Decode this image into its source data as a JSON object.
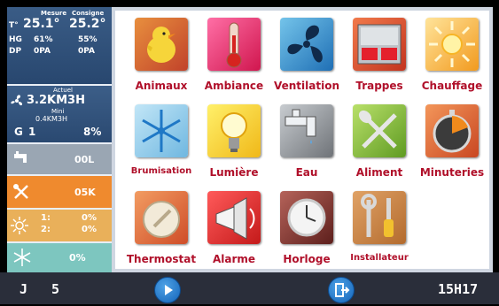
{
  "sidebar": {
    "mesure": {
      "header_mesure": "Mesure",
      "header_consigne": "Consigne",
      "t_label": "T°",
      "t_mesure": "25.1°",
      "t_consigne": "25.2°",
      "hg_label": "HG",
      "hg_mesure": "61%",
      "hg_consigne": "55%",
      "dp_label": "DP",
      "dp_mesure": "0PA",
      "dp_consigne": "0PA"
    },
    "air": {
      "actuel_label": "Actuel",
      "actuel_value": "3.2KM3H",
      "mini_label": "Mini",
      "mini_value": "0.4KM3H",
      "g_label": "G",
      "g_value": "1",
      "percent": "8%"
    },
    "eau": {
      "value": "00L"
    },
    "aliment": {
      "value": "05K"
    },
    "chauffage": {
      "line1_label": "1:",
      "line1_value": "0%",
      "line2_label": "2:",
      "line2_value": "0%"
    },
    "brumisation": {
      "value": "0%"
    }
  },
  "tiles": [
    {
      "label": "Animaux",
      "icon": "chick-icon"
    },
    {
      "label": "Ambiance",
      "icon": "thermometer-icon"
    },
    {
      "label": "Ventilation",
      "icon": "fan-icon"
    },
    {
      "label": "Trappes",
      "icon": "trap-door-icon"
    },
    {
      "label": "Chauffage",
      "icon": "sun-icon"
    },
    {
      "label": "Brumisation",
      "icon": "snowflake-icon"
    },
    {
      "label": "Lumière",
      "icon": "lightbulb-icon"
    },
    {
      "label": "Eau",
      "icon": "faucet-icon"
    },
    {
      "label": "Aliment",
      "icon": "fork-spoon-icon"
    },
    {
      "label": "Minuteries",
      "icon": "stopwatch-icon"
    },
    {
      "label": "Thermostat",
      "icon": "dial-icon"
    },
    {
      "label": "Alarme",
      "icon": "megaphone-icon"
    },
    {
      "label": "Horloge",
      "icon": "clock-icon"
    },
    {
      "label": "Installateur",
      "icon": "tools-icon"
    }
  ],
  "footer": {
    "day_label": "J",
    "day_value": "5",
    "time": "15H17",
    "play_icon": "play-icon",
    "exit_icon": "exit-icon"
  },
  "colors": {
    "label_red": "#b0102a",
    "panel_blue": "#2a4971",
    "footer_bg": "#2a2e3a",
    "aliment_orange": "#ef8a2e",
    "brum_teal": "#7dc6bf"
  }
}
